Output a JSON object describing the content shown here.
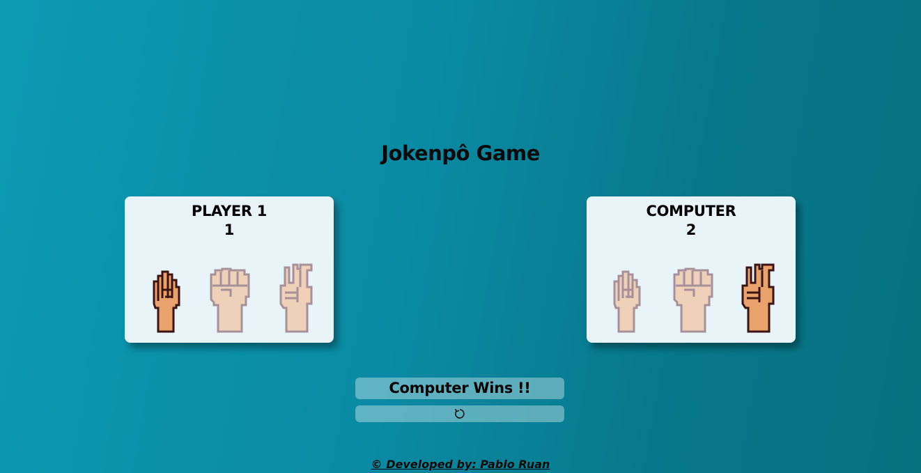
{
  "title": "Jokenpô Game",
  "player": {
    "name": "PLAYER 1",
    "score": "1",
    "choices": [
      "rock",
      "paper",
      "scissors"
    ],
    "selected": "rock"
  },
  "computer": {
    "name": "COMPUTER",
    "score": "2",
    "choices": [
      "rock",
      "paper",
      "scissors"
    ],
    "selected": "scissors"
  },
  "result": "Computer Wins !!",
  "reset_icon": "reset-icon",
  "footer": "© Developed by: Pablo Ruan",
  "colors": {
    "skin_active": "#eaa26c",
    "skin_inactive": "#efd1b9",
    "outline_active": "#3a1414",
    "outline_inactive": "#a7909a",
    "card_bg": "#e9f4f8"
  }
}
